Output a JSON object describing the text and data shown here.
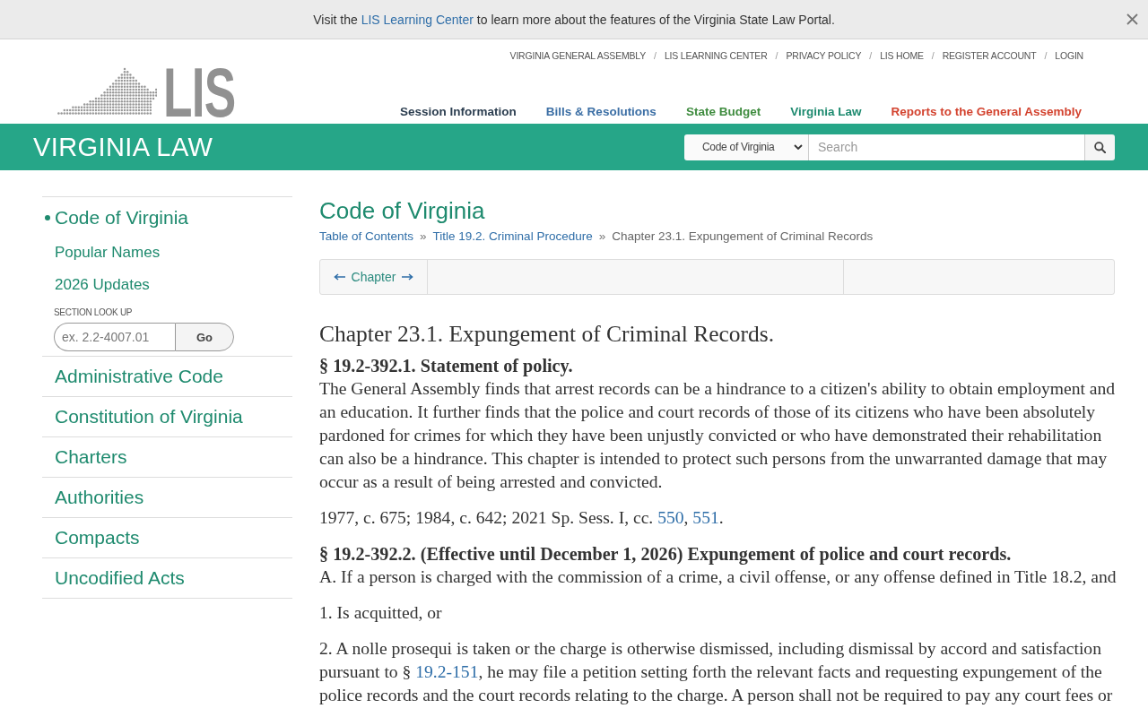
{
  "notice": {
    "runs": [
      {
        "kind": "text",
        "text": "Visit the "
      },
      {
        "kind": "link",
        "text": "LIS Learning Center"
      },
      {
        "kind": "text",
        "text": " to learn more about the features of the Virginia State Law Portal."
      }
    ]
  },
  "top_links": {
    "separator": "/",
    "items": [
      "VIRGINIA GENERAL ASSEMBLY",
      "LIS LEARNING CENTER",
      "PRIVACY POLICY",
      "LIS HOME",
      "REGISTER ACCOUNT",
      "LOGIN"
    ]
  },
  "logo": {
    "text": "LIS"
  },
  "main_nav": [
    {
      "label": "Session Information",
      "color": "#2c3e50"
    },
    {
      "label": "Bills & Resolutions",
      "color": "#3c6fa5"
    },
    {
      "label": "State Budget",
      "color": "#3f8c3f"
    },
    {
      "label": "Virginia Law",
      "color": "#1d8a6f"
    },
    {
      "label": "Reports to the General Assembly",
      "color": "#d3432f"
    }
  ],
  "section_bar": {
    "title": "VIRGINIA LAW",
    "search": {
      "scope": "Code of Virginia",
      "placeholder": "Search"
    }
  },
  "sidebar": {
    "items": [
      {
        "label": "Code of Virginia",
        "selected": true,
        "children": [
          {
            "label": "Popular Names"
          },
          {
            "label": "2026 Updates"
          }
        ],
        "section_lookup": {
          "label": "SECTION LOOK UP",
          "placeholder": "ex. 2.2-4007.01",
          "button": "Go"
        }
      },
      {
        "label": "Administrative Code",
        "selected": false
      },
      {
        "label": "Constitution of Virginia",
        "selected": false
      },
      {
        "label": "Charters",
        "selected": false
      },
      {
        "label": "Authorities",
        "selected": false
      },
      {
        "label": "Compacts",
        "selected": false
      },
      {
        "label": "Uncodified Acts",
        "selected": false
      }
    ]
  },
  "content": {
    "title": "Code of Virginia",
    "breadcrumbs": {
      "separator": "»",
      "items": [
        {
          "kind": "link",
          "label": "Table of Contents"
        },
        {
          "kind": "link",
          "label": "Title 19.2. Criminal Procedure"
        },
        {
          "kind": "current",
          "label": "Chapter 23.1. Expungement of Criminal Records"
        }
      ]
    },
    "pager": {
      "label": "Chapter"
    },
    "chapter_title": "Chapter 23.1. Expungement of Criminal Records.",
    "sections": [
      {
        "heading": "§ 19.2-392.1. Statement of policy.",
        "paragraphs": [
          [
            {
              "kind": "text",
              "text": "The General Assembly finds that arrest records can be a hindrance to a citizen's ability to obtain employment and an education. It further finds that the police and court records of those of its citizens who have been absolutely pardoned for crimes for which they have been unjustly convicted or who have demonstrated their rehabilitation can also be a hindrance. This chapter is intended to protect such persons from the unwarranted damage that may occur as a result of being arrested and convicted."
            }
          ],
          [
            {
              "kind": "text",
              "text": "1977, c. 675; 1984, c. 642; 2021 Sp. Sess. I, cc. "
            },
            {
              "kind": "link",
              "text": "550"
            },
            {
              "kind": "text",
              "text": ", "
            },
            {
              "kind": "link",
              "text": "551"
            },
            {
              "kind": "text",
              "text": "."
            }
          ]
        ]
      },
      {
        "heading": "§ 19.2-392.2. (Effective until December 1, 2026) Expungement of police and court records.",
        "paragraphs": [
          [
            {
              "kind": "text",
              "text": "A. If a person is charged with the commission of a crime, a civil offense, or any offense defined in Title 18.2, and"
            }
          ],
          [
            {
              "kind": "text",
              "text": "1. Is acquitted, or"
            }
          ],
          [
            {
              "kind": "text",
              "text": "2. A nolle prosequi is taken or the charge is otherwise dismissed, including dismissal by accord and satisfaction pursuant to § "
            },
            {
              "kind": "link",
              "text": "19.2-151"
            },
            {
              "kind": "text",
              "text": ", he may file a petition setting forth the relevant facts and requesting expungement of the police records and the court records relating to the charge. A person shall not be required to pay any court fees or"
            }
          ]
        ]
      }
    ]
  }
}
